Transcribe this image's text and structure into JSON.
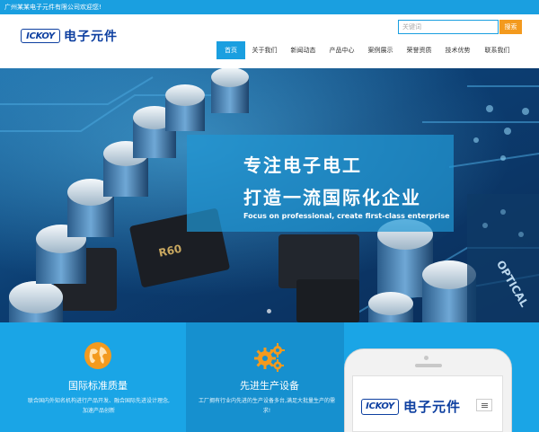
{
  "topbar": {
    "welcome": "广州某某电子元件有限公司欢迎您!"
  },
  "logo": {
    "badge": "ICKOY",
    "name": "电子元件"
  },
  "search": {
    "placeholder": "关键词",
    "button": "搜索"
  },
  "nav": {
    "items": [
      {
        "label": "首页",
        "active": true
      },
      {
        "label": "关于我们",
        "active": false
      },
      {
        "label": "新闻动态",
        "active": false
      },
      {
        "label": "产品中心",
        "active": false
      },
      {
        "label": "案例展示",
        "active": false
      },
      {
        "label": "荣誉资质",
        "active": false
      },
      {
        "label": "技术优势",
        "active": false
      },
      {
        "label": "联系我们",
        "active": false
      }
    ]
  },
  "banner": {
    "line1": "专注电子电工",
    "line2": "打造一流国际化企业",
    "line3": "Focus on professional, create first-class enterprise",
    "chip_label": "R60",
    "board_label": "OPTICAL"
  },
  "features": [
    {
      "title": "国际标准质量",
      "desc_line1": "联合国内外知名机构进行产品开发、融合国际先进设计理念,",
      "desc_line2": "加速产品创新",
      "icon": "globe-icon"
    },
    {
      "title": "先进生产设备",
      "desc_line1": "工厂拥有行业内先进的生产设备多台,满足大批量生产的需",
      "desc_line2": "求!",
      "icon": "gears-icon"
    }
  ],
  "phone": {
    "badge": "ICKOY",
    "name": "电子元件"
  },
  "colors": {
    "primary": "#1a9fe0",
    "accent": "#f39a1e",
    "brand": "#0d3fa0"
  }
}
